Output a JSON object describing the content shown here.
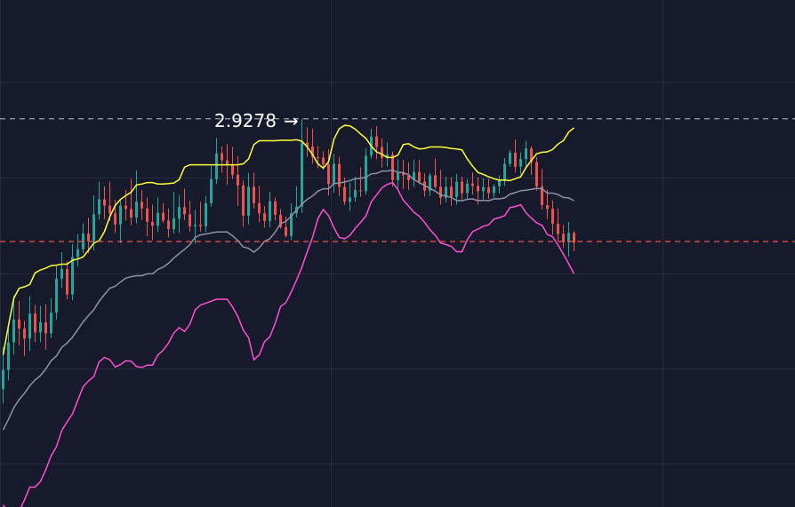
{
  "chart_data": {
    "type": "candlestick",
    "title": "",
    "xlabel": "",
    "ylabel": "",
    "ylim": [
      2.15,
      3.175
    ],
    "grid": true,
    "legend": "none",
    "colors": {
      "background": "#161a2b",
      "grid": "#262b3f",
      "up": "#26a69a",
      "down": "#ef5350",
      "upper_band": "#ffff3a",
      "middle_band": "#8d93a6",
      "lower_band": "#ff4fd3",
      "high_price_line": "#9aa0b0",
      "low_price_line": "#ef5350",
      "annotation_text": "#ffffff"
    },
    "annotation": {
      "text": "2.9278",
      "arrow": "→",
      "value": 2.9278
    },
    "reference_lines": [
      {
        "name": "high",
        "value": 2.9278
      },
      {
        "name": "low",
        "value": 2.6722
      }
    ],
    "bands": {
      "upper": [
        2.436,
        2.497,
        2.554,
        2.575,
        2.578,
        2.583,
        2.607,
        2.613,
        2.617,
        2.622,
        2.623,
        2.625,
        2.625,
        2.633,
        2.636,
        2.64,
        2.654,
        2.669,
        2.674,
        2.693,
        2.724,
        2.747,
        2.76,
        2.768,
        2.775,
        2.79,
        2.792,
        2.795,
        2.795,
        2.792,
        2.792,
        2.793,
        2.794,
        2.801,
        2.827,
        2.832,
        2.832,
        2.832,
        2.832,
        2.832,
        2.832,
        2.832,
        2.832,
        2.832,
        2.832,
        2.834,
        2.844,
        2.874,
        2.882,
        2.882,
        2.882,
        2.882,
        2.883,
        2.883,
        2.883,
        2.884,
        2.881,
        2.869,
        2.853,
        2.834,
        2.825,
        2.838,
        2.885,
        2.907,
        2.914,
        2.913,
        2.906,
        2.896,
        2.887,
        2.871,
        2.859,
        2.854,
        2.847,
        2.847,
        2.852,
        2.874,
        2.876,
        2.869,
        2.865,
        2.866,
        2.869,
        2.869,
        2.869,
        2.868,
        2.866,
        2.865,
        2.863,
        2.844,
        2.829,
        2.816,
        2.812,
        2.807,
        2.803,
        2.8,
        2.8,
        2.799,
        2.803,
        2.807,
        2.826,
        2.841,
        2.855,
        2.858,
        2.859,
        2.864,
        2.875,
        2.882,
        2.9,
        2.909
      ],
      "middle": [
        2.28,
        2.302,
        2.326,
        2.343,
        2.356,
        2.372,
        2.384,
        2.393,
        2.407,
        2.424,
        2.434,
        2.452,
        2.461,
        2.473,
        2.489,
        2.505,
        2.518,
        2.53,
        2.548,
        2.562,
        2.575,
        2.579,
        2.588,
        2.596,
        2.599,
        2.601,
        2.601,
        2.605,
        2.605,
        2.614,
        2.619,
        2.627,
        2.638,
        2.647,
        2.656,
        2.666,
        2.681,
        2.686,
        2.688,
        2.69,
        2.692,
        2.692,
        2.692,
        2.684,
        2.674,
        2.661,
        2.658,
        2.65,
        2.659,
        2.673,
        2.678,
        2.692,
        2.71,
        2.714,
        2.725,
        2.738,
        2.75,
        2.76,
        2.767,
        2.777,
        2.782,
        2.782,
        2.793,
        2.794,
        2.796,
        2.799,
        2.803,
        2.804,
        2.806,
        2.813,
        2.814,
        2.819,
        2.819,
        2.821,
        2.816,
        2.816,
        2.811,
        2.801,
        2.795,
        2.789,
        2.783,
        2.777,
        2.769,
        2.767,
        2.764,
        2.758,
        2.757,
        2.76,
        2.761,
        2.757,
        2.758,
        2.757,
        2.761,
        2.761,
        2.763,
        2.771,
        2.774,
        2.778,
        2.779,
        2.781,
        2.783,
        2.782,
        2.773,
        2.773,
        2.77,
        2.764,
        2.763,
        2.757
      ]
    },
    "x": [
      0,
      1,
      2,
      3,
      4,
      5,
      6,
      7,
      8,
      9,
      10,
      11,
      12,
      13,
      14,
      15,
      16,
      17,
      18,
      19,
      20,
      21,
      22,
      23,
      24,
      25,
      26,
      27,
      28,
      29,
      30,
      31,
      32,
      33,
      34,
      35,
      36,
      37,
      38,
      39,
      40,
      41,
      42,
      43,
      44,
      45,
      46,
      47,
      48,
      49,
      50,
      51,
      52,
      53,
      54,
      55,
      56,
      57,
      58,
      59,
      60,
      61,
      62,
      63,
      64,
      65,
      66,
      67,
      68,
      69,
      70,
      71,
      72,
      73,
      74,
      75,
      76,
      77,
      78,
      79,
      80,
      81,
      82,
      83,
      84,
      85,
      86,
      87,
      88,
      89,
      90,
      91,
      92,
      93,
      94,
      95,
      96,
      97,
      98,
      99,
      100,
      101,
      102,
      103,
      104,
      105,
      106,
      107
    ],
    "candles": [
      [
        2.365,
        2.452,
        2.335,
        2.405
      ],
      [
        2.405,
        2.492,
        2.383,
        2.462
      ],
      [
        2.462,
        2.56,
        2.437,
        2.51
      ],
      [
        2.51,
        2.549,
        2.456,
        2.491
      ],
      [
        2.491,
        2.507,
        2.434,
        2.47
      ],
      [
        2.47,
        2.558,
        2.444,
        2.522
      ],
      [
        2.522,
        2.54,
        2.463,
        2.483
      ],
      [
        2.483,
        2.538,
        2.463,
        2.504
      ],
      [
        2.504,
        2.541,
        2.447,
        2.481
      ],
      [
        2.481,
        2.554,
        2.471,
        2.524
      ],
      [
        2.524,
        2.623,
        2.51,
        2.595
      ],
      [
        2.595,
        2.65,
        2.576,
        2.615
      ],
      [
        2.615,
        2.631,
        2.552,
        2.562
      ],
      [
        2.562,
        2.667,
        2.55,
        2.64
      ],
      [
        2.64,
        2.688,
        2.62,
        2.656
      ],
      [
        2.656,
        2.71,
        2.648,
        2.689
      ],
      [
        2.689,
        2.722,
        2.648,
        2.673
      ],
      [
        2.673,
        2.768,
        2.654,
        2.729
      ],
      [
        2.729,
        2.797,
        2.718,
        2.76
      ],
      [
        2.76,
        2.787,
        2.719,
        2.747
      ],
      [
        2.747,
        2.797,
        2.715,
        2.731
      ],
      [
        2.731,
        2.759,
        2.69,
        2.708
      ],
      [
        2.708,
        2.759,
        2.669,
        2.747
      ],
      [
        2.747,
        2.78,
        2.716,
        2.74
      ],
      [
        2.74,
        2.803,
        2.706,
        2.722
      ],
      [
        2.722,
        2.82,
        2.71,
        2.755
      ],
      [
        2.755,
        2.779,
        2.717,
        2.741
      ],
      [
        2.741,
        2.764,
        2.683,
        2.713
      ],
      [
        2.713,
        2.749,
        2.675,
        2.705
      ],
      [
        2.705,
        2.764,
        2.692,
        2.732
      ],
      [
        2.732,
        2.752,
        2.711,
        2.716
      ],
      [
        2.716,
        2.741,
        2.681,
        2.698
      ],
      [
        2.698,
        2.776,
        2.689,
        2.72
      ],
      [
        2.72,
        2.769,
        2.69,
        2.744
      ],
      [
        2.744,
        2.782,
        2.717,
        2.729
      ],
      [
        2.729,
        2.757,
        2.693,
        2.704
      ],
      [
        2.704,
        2.738,
        2.668,
        2.707
      ],
      [
        2.707,
        2.755,
        2.693,
        2.704
      ],
      [
        2.704,
        2.767,
        2.692,
        2.752
      ],
      [
        2.752,
        2.831,
        2.745,
        2.802
      ],
      [
        2.802,
        2.888,
        2.792,
        2.856
      ],
      [
        2.856,
        2.87,
        2.815,
        2.841
      ],
      [
        2.841,
        2.875,
        2.79,
        2.833
      ],
      [
        2.833,
        2.869,
        2.803,
        2.811
      ],
      [
        2.811,
        2.85,
        2.746,
        2.789
      ],
      [
        2.789,
        2.799,
        2.703,
        2.726
      ],
      [
        2.726,
        2.815,
        2.708,
        2.786
      ],
      [
        2.786,
        2.815,
        2.741,
        2.752
      ],
      [
        2.752,
        2.788,
        2.713,
        2.731
      ],
      [
        2.731,
        2.746,
        2.701,
        2.715
      ],
      [
        2.715,
        2.776,
        2.702,
        2.756
      ],
      [
        2.756,
        2.764,
        2.716,
        2.728
      ],
      [
        2.728,
        2.74,
        2.699,
        2.702
      ],
      [
        2.702,
        2.724,
        2.681,
        2.684
      ],
      [
        2.684,
        2.752,
        2.675,
        2.731
      ],
      [
        2.731,
        2.788,
        2.722,
        2.745
      ],
      [
        2.745,
        2.928,
        2.732,
        2.878
      ],
      [
        2.878,
        2.91,
        2.849,
        2.87
      ],
      [
        2.87,
        2.907,
        2.834,
        2.848
      ],
      [
        2.848,
        2.871,
        2.825,
        2.847
      ],
      [
        2.847,
        2.86,
        2.822,
        2.833
      ],
      [
        2.833,
        2.864,
        2.768,
        2.792
      ],
      [
        2.792,
        2.855,
        2.774,
        2.834
      ],
      [
        2.834,
        2.849,
        2.767,
        2.786
      ],
      [
        2.786,
        2.806,
        2.748,
        2.755
      ],
      [
        2.755,
        2.795,
        2.736,
        2.764
      ],
      [
        2.764,
        2.807,
        2.755,
        2.779
      ],
      [
        2.779,
        2.826,
        2.765,
        2.777
      ],
      [
        2.777,
        2.866,
        2.77,
        2.851
      ],
      [
        2.851,
        2.907,
        2.845,
        2.891
      ],
      [
        2.891,
        2.912,
        2.844,
        2.869
      ],
      [
        2.869,
        2.887,
        2.826,
        2.846
      ],
      [
        2.846,
        2.878,
        2.828,
        2.853
      ],
      [
        2.853,
        2.86,
        2.786,
        2.8
      ],
      [
        2.8,
        2.844,
        2.782,
        2.815
      ],
      [
        2.815,
        2.842,
        2.782,
        2.81
      ],
      [
        2.81,
        2.837,
        2.78,
        2.8
      ],
      [
        2.8,
        2.843,
        2.786,
        2.817
      ],
      [
        2.817,
        2.842,
        2.791,
        2.797
      ],
      [
        2.797,
        2.814,
        2.766,
        2.778
      ],
      [
        2.778,
        2.815,
        2.767,
        2.81
      ],
      [
        2.81,
        2.845,
        2.782,
        2.786
      ],
      [
        2.786,
        2.822,
        2.749,
        2.763
      ],
      [
        2.763,
        2.807,
        2.754,
        2.786
      ],
      [
        2.786,
        2.806,
        2.746,
        2.765
      ],
      [
        2.765,
        2.813,
        2.749,
        2.797
      ],
      [
        2.797,
        2.807,
        2.76,
        2.773
      ],
      [
        2.773,
        2.802,
        2.759,
        2.793
      ],
      [
        2.793,
        2.816,
        2.77,
        2.788
      ],
      [
        2.788,
        2.806,
        2.749,
        2.777
      ],
      [
        2.777,
        2.804,
        2.76,
        2.785
      ],
      [
        2.785,
        2.803,
        2.761,
        2.773
      ],
      [
        2.773,
        2.792,
        2.763,
        2.787
      ],
      [
        2.787,
        2.81,
        2.773,
        2.8
      ],
      [
        2.8,
        2.846,
        2.788,
        2.834
      ],
      [
        2.834,
        2.863,
        2.828,
        2.857
      ],
      [
        2.857,
        2.885,
        2.816,
        2.828
      ],
      [
        2.828,
        2.858,
        2.812,
        2.844
      ],
      [
        2.844,
        2.882,
        2.823,
        2.866
      ],
      [
        2.866,
        2.871,
        2.811,
        2.837
      ],
      [
        2.837,
        2.848,
        2.778,
        2.787
      ],
      [
        2.787,
        2.823,
        2.739,
        2.748
      ],
      [
        2.748,
        2.78,
        2.719,
        2.74
      ],
      [
        2.74,
        2.758,
        2.686,
        2.709
      ],
      [
        2.709,
        2.741,
        2.674,
        2.688
      ],
      [
        2.688,
        2.707,
        2.66,
        2.671
      ],
      [
        2.671,
        2.713,
        2.641,
        2.69
      ],
      [
        2.69,
        2.694,
        2.652,
        2.67
      ]
    ]
  }
}
